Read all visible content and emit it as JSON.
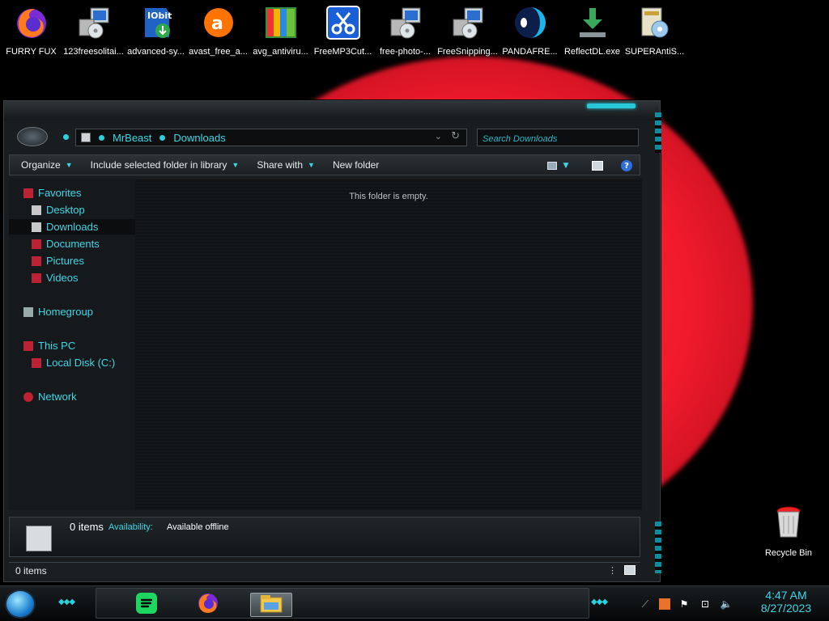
{
  "desktop_icons": [
    {
      "label": "FURRY FUX",
      "icon": "firefox-icon"
    },
    {
      "label": "123freesolitai...",
      "icon": "installer-icon"
    },
    {
      "label": "advanced-sy...",
      "icon": "iobit-icon"
    },
    {
      "label": "avast_free_a...",
      "icon": "avast-icon"
    },
    {
      "label": "avg_antiviru...",
      "icon": "avg-icon"
    },
    {
      "label": "FreeMP3Cut...",
      "icon": "scissors-icon"
    },
    {
      "label": "free-photo-...",
      "icon": "installer-icon"
    },
    {
      "label": "FreeSnipping...",
      "icon": "installer-icon"
    },
    {
      "label": "PANDAFRE...",
      "icon": "panda-icon"
    },
    {
      "label": "ReflectDL.exe",
      "icon": "download-icon"
    },
    {
      "label": "SUPERAntiS...",
      "icon": "setup-disc-icon"
    }
  ],
  "recycle_bin": {
    "label": "Recycle Bin"
  },
  "explorer": {
    "breadcrumb": [
      "MrBeast",
      "Downloads"
    ],
    "search_placeholder": "Search Downloads",
    "toolbar": {
      "organize": "Organize",
      "include": "Include selected folder in library",
      "share": "Share with",
      "new_folder": "New folder"
    },
    "nav": {
      "favorites": "Favorites",
      "desktop": "Desktop",
      "downloads": "Downloads",
      "documents": "Documents",
      "pictures": "Pictures",
      "videos": "Videos",
      "homegroup": "Homegroup",
      "this_pc": "This PC",
      "local_disk": "Local Disk (C:)",
      "network": "Network"
    },
    "empty_message": "This folder is empty.",
    "details": {
      "count": "0 items",
      "availability_label": "Availability:",
      "availability_value": "Available offline"
    },
    "status": "0 items"
  },
  "taskbar": {
    "apps": [
      "spotify-icon",
      "firefox-icon",
      "file-explorer-icon"
    ],
    "clock_time": "4:47 AM",
    "clock_date": "8/27/2023"
  },
  "colors": {
    "accent": "#3ed6e6",
    "wallpaper": "#f01a2c"
  }
}
